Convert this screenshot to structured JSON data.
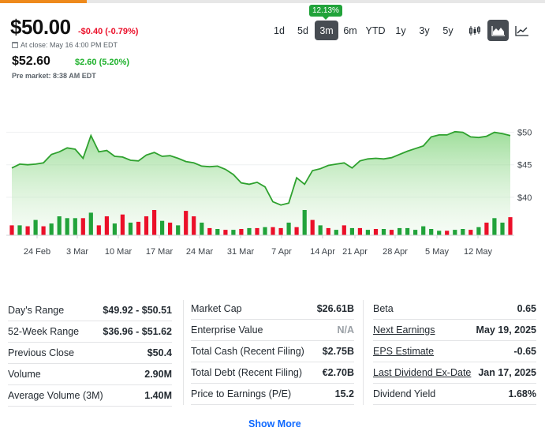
{
  "quote": {
    "price": "$50.00",
    "change": "-$0.40 (-0.79%)",
    "close_info": "At close: May 16 4:00 PM EDT",
    "pre_price": "$52.60",
    "pre_change": "$2.60 (5.20%)",
    "pre_info": "Pre market: 8:38 AM EDT"
  },
  "range": {
    "tooltip": "12.13%",
    "options": [
      "1d",
      "5d",
      "3m",
      "6m",
      "YTD",
      "1y",
      "3y",
      "5y"
    ],
    "selected": "3m"
  },
  "chart_types": [
    "candlestick-icon",
    "mountain-icon",
    "line-icon"
  ],
  "colors": {
    "up": "#21a33a",
    "down": "#eb0f29",
    "accent": "#ee8a1c",
    "link": "#0f69ff"
  },
  "chart_data": {
    "type": "area",
    "x_tick_labels": [
      "24 Feb",
      "3 Mar",
      "10 Mar",
      "17 Mar",
      "24 Mar",
      "31 Mar",
      "7 Apr",
      "14 Apr",
      "21 Apr",
      "28 Apr",
      "5 May",
      "12 May"
    ],
    "y_tick_labels": [
      "$50",
      "$45",
      "$40"
    ],
    "ylim": [
      35.6,
      51.9
    ],
    "price_series": [
      44.5,
      45.1,
      45.0,
      45.1,
      45.3,
      46.6,
      47.0,
      47.6,
      47.4,
      46.0,
      49.5,
      47.0,
      47.2,
      46.3,
      46.2,
      45.7,
      45.6,
      46.5,
      46.9,
      46.3,
      46.4,
      46.0,
      45.5,
      45.3,
      44.8,
      44.7,
      44.8,
      44.3,
      43.5,
      42.2,
      42.0,
      42.3,
      41.6,
      39.3,
      38.8,
      39.1,
      43.0,
      42.0,
      44.1,
      44.4,
      44.9,
      45.1,
      45.3,
      44.5,
      45.6,
      45.9,
      46.0,
      45.9,
      46.1,
      46.6,
      47.1,
      47.5,
      47.9,
      49.3,
      49.6,
      49.6,
      50.1,
      50.0,
      49.3,
      49.2,
      49.4,
      50.0,
      49.8,
      49.5
    ],
    "volume_series": [
      {
        "v": 0.55,
        "up": false
      },
      {
        "v": 0.55,
        "up": true
      },
      {
        "v": 0.5,
        "up": false
      },
      {
        "v": 0.85,
        "up": true
      },
      {
        "v": 0.5,
        "up": false
      },
      {
        "v": 0.65,
        "up": true
      },
      {
        "v": 1.05,
        "up": true
      },
      {
        "v": 0.95,
        "up": true
      },
      {
        "v": 0.95,
        "up": true
      },
      {
        "v": 0.95,
        "up": false
      },
      {
        "v": 1.25,
        "up": true
      },
      {
        "v": 0.55,
        "up": false
      },
      {
        "v": 1.05,
        "up": false
      },
      {
        "v": 0.65,
        "up": true
      },
      {
        "v": 1.15,
        "up": false
      },
      {
        "v": 0.7,
        "up": true
      },
      {
        "v": 0.75,
        "up": false
      },
      {
        "v": 1.05,
        "up": false
      },
      {
        "v": 1.4,
        "up": false
      },
      {
        "v": 0.8,
        "up": true
      },
      {
        "v": 0.7,
        "up": false
      },
      {
        "v": 0.55,
        "up": true
      },
      {
        "v": 1.35,
        "up": false
      },
      {
        "v": 1.05,
        "up": false
      },
      {
        "v": 0.7,
        "up": true
      },
      {
        "v": 0.4,
        "up": false
      },
      {
        "v": 0.35,
        "up": true
      },
      {
        "v": 0.3,
        "up": false
      },
      {
        "v": 0.3,
        "up": true
      },
      {
        "v": 0.35,
        "up": false
      },
      {
        "v": 0.4,
        "up": true
      },
      {
        "v": 0.4,
        "up": false
      },
      {
        "v": 0.45,
        "up": true
      },
      {
        "v": 0.45,
        "up": false
      },
      {
        "v": 0.4,
        "up": false
      },
      {
        "v": 0.7,
        "up": true
      },
      {
        "v": 0.45,
        "up": false
      },
      {
        "v": 1.4,
        "up": true
      },
      {
        "v": 0.85,
        "up": false
      },
      {
        "v": 0.55,
        "up": true
      },
      {
        "v": 0.4,
        "up": false
      },
      {
        "v": 0.3,
        "up": true
      },
      {
        "v": 0.55,
        "up": false
      },
      {
        "v": 0.4,
        "up": true
      },
      {
        "v": 0.4,
        "up": false
      },
      {
        "v": 0.3,
        "up": true
      },
      {
        "v": 0.35,
        "up": false
      },
      {
        "v": 0.35,
        "up": true
      },
      {
        "v": 0.3,
        "up": false
      },
      {
        "v": 0.4,
        "up": true
      },
      {
        "v": 0.4,
        "up": true
      },
      {
        "v": 0.3,
        "up": true
      },
      {
        "v": 0.5,
        "up": true
      },
      {
        "v": 0.35,
        "up": true
      },
      {
        "v": 0.25,
        "up": true
      },
      {
        "v": 0.25,
        "up": false
      },
      {
        "v": 0.3,
        "up": true
      },
      {
        "v": 0.35,
        "up": true
      },
      {
        "v": 0.3,
        "up": false
      },
      {
        "v": 0.45,
        "up": true
      },
      {
        "v": 0.7,
        "up": false
      },
      {
        "v": 0.95,
        "up": true
      },
      {
        "v": 0.7,
        "up": true
      },
      {
        "v": 1.0,
        "up": false
      }
    ]
  },
  "stats": {
    "col1": [
      {
        "label": "Day's Range",
        "value": "$49.92 - $50.51"
      },
      {
        "label": "52-Week Range",
        "value": "$36.96 - $51.62"
      },
      {
        "label": "Previous Close",
        "value": "$50.4"
      },
      {
        "label": "Volume",
        "value": "2.90M"
      },
      {
        "label": "Average Volume (3M)",
        "value": "1.40M"
      }
    ],
    "col2": [
      {
        "label": "Market Cap",
        "value": "$26.61B"
      },
      {
        "label": "Enterprise Value",
        "value": "N/A"
      },
      {
        "label": "Total Cash (Recent Filing)",
        "value": "$2.75B"
      },
      {
        "label": "Total Debt (Recent Filing)",
        "value": "€2.70B"
      },
      {
        "label": "Price to Earnings (P/E)",
        "value": "15.2"
      }
    ],
    "col3": [
      {
        "label": "Beta",
        "value": "0.65"
      },
      {
        "label": "Next Earnings",
        "value": "May 19, 2025"
      },
      {
        "label": "EPS Estimate",
        "value": "-0.65"
      },
      {
        "label": "Last Dividend Ex-Date",
        "value": "Jan 17, 2025"
      },
      {
        "label": "Dividend Yield",
        "value": "1.68%"
      }
    ]
  },
  "show_more": "Show More"
}
